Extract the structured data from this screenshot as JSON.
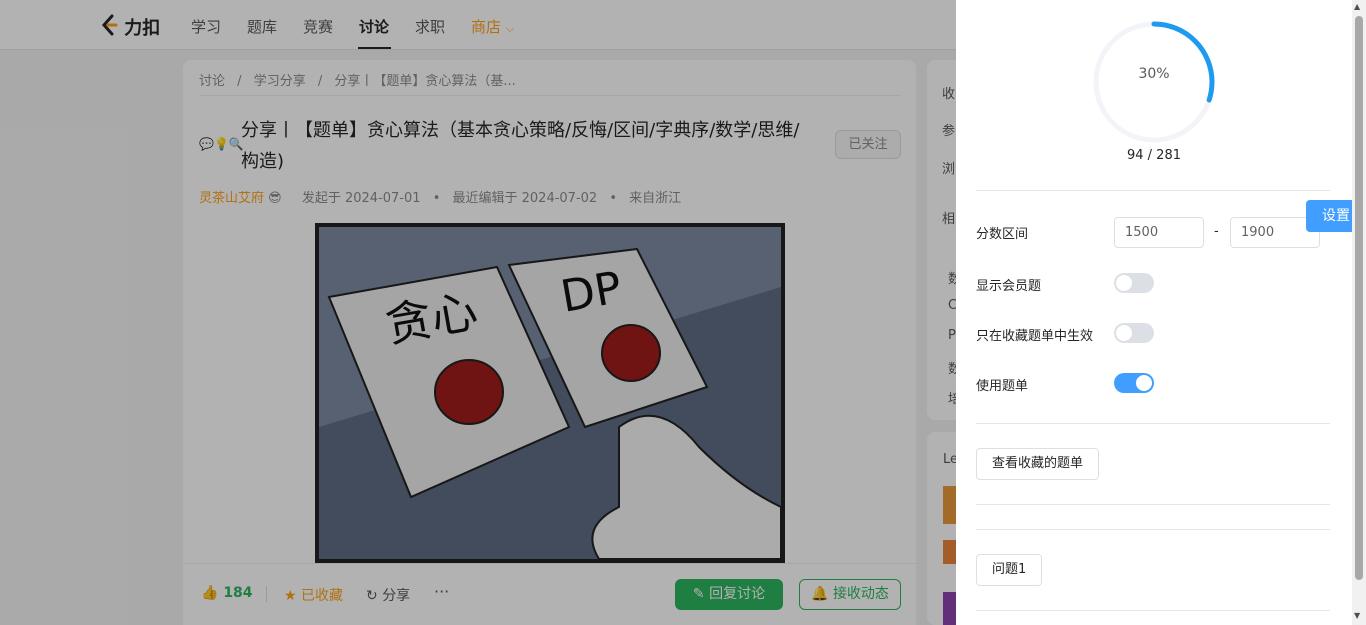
{
  "nav": {
    "logo": "力扣",
    "items": [
      "学习",
      "题库",
      "竞赛",
      "讨论",
      "求职"
    ],
    "store": "商店"
  },
  "post": {
    "breadcrumb": [
      "讨论",
      "学习分享",
      "分享丨【题单】贪心算法（基..."
    ],
    "title": "分享丨【题单】贪心算法（基本贪心策略/反悔/区间/字典序/数学/思维/构造)",
    "follow_label": "已关注",
    "author": "灵茶山艾府",
    "created": "发起于 2024-07-01",
    "edited": "最近编辑于 2024-07-02",
    "location": "来自浙江",
    "meme_text_left": "贪心",
    "meme_text_right": "DP",
    "likes": "184",
    "favorited_label": "已收藏",
    "share_label": "分享",
    "more_label": "···",
    "reply_label": "回复讨论",
    "subscribe_label": "接收动态"
  },
  "sidebar_peek": {
    "items": [
      "收",
      "参",
      "浏",
      "相",
      "数",
      "C",
      "P",
      "数",
      "培"
    ],
    "lower": "Le"
  },
  "panel": {
    "progress_label": "30%",
    "progress_fraction": 0.3,
    "solved": "94 / 281",
    "score_range_label": "分数区间",
    "score_min": "1500",
    "score_max": "1900",
    "score_dash": "-",
    "show_member_label": "显示会员题",
    "show_member_on": false,
    "fav_only_label": "只在收藏题单中生效",
    "fav_only_on": false,
    "use_list_label": "使用题单",
    "use_list_on": true,
    "view_fav_label": "查看收藏的题单",
    "problem_label": "问题1",
    "settings_label": "设置"
  },
  "colors": {
    "accent_green": "#2db55d",
    "accent_orange": "#ffa116",
    "accent_blue": "#409eff",
    "progress_blue": "#1e9bf0"
  }
}
